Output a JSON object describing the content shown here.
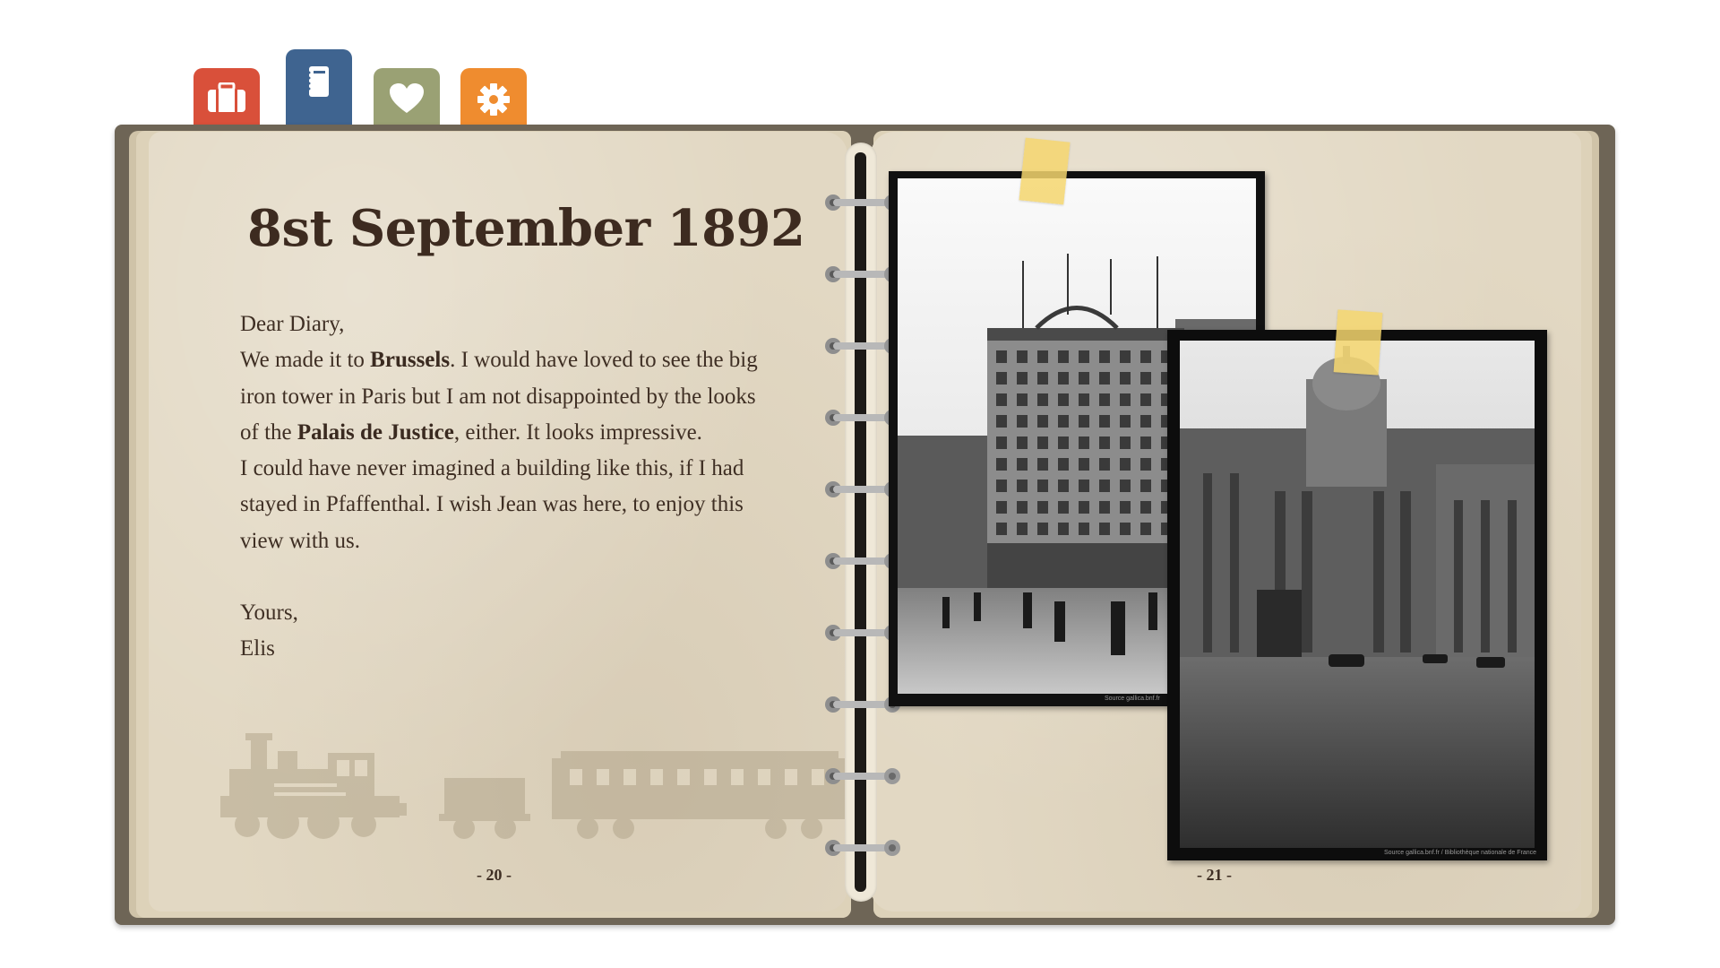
{
  "tabs": [
    {
      "name": "travel",
      "icon": "suitcase-icon",
      "color": "#d9503a"
    },
    {
      "name": "diary",
      "icon": "notebook-icon",
      "color": "#3f6490"
    },
    {
      "name": "favorites",
      "icon": "heart-icon",
      "color": "#9aa174"
    },
    {
      "name": "settings",
      "icon": "gear-icon",
      "color": "#ef8c2f"
    }
  ],
  "left_page": {
    "title": "8st September 1892",
    "salutation": "Dear Diary,",
    "p1_a": "We made it to ",
    "p1_b": "Brussels",
    "p1_c": ". I would have loved to see the big iron tower in Paris but I am not disappointed by the looks of the ",
    "p1_d": "Palais de Justice",
    "p1_e": ", either. It looks impressive.",
    "p2": "I could have never imagined a building like this, if I had stayed in Pfaffenthal. I wish Jean was here, to enjoy this view with us.",
    "closing": "Yours,",
    "signature": "Elis",
    "page_number": "- 20 -"
  },
  "right_page": {
    "page_number": "- 21 -",
    "photo1_credit": "Source gallica.bnf.fr",
    "photo2_credit": "Source gallica.bnf.fr / Bibliothèque nationale de France"
  }
}
